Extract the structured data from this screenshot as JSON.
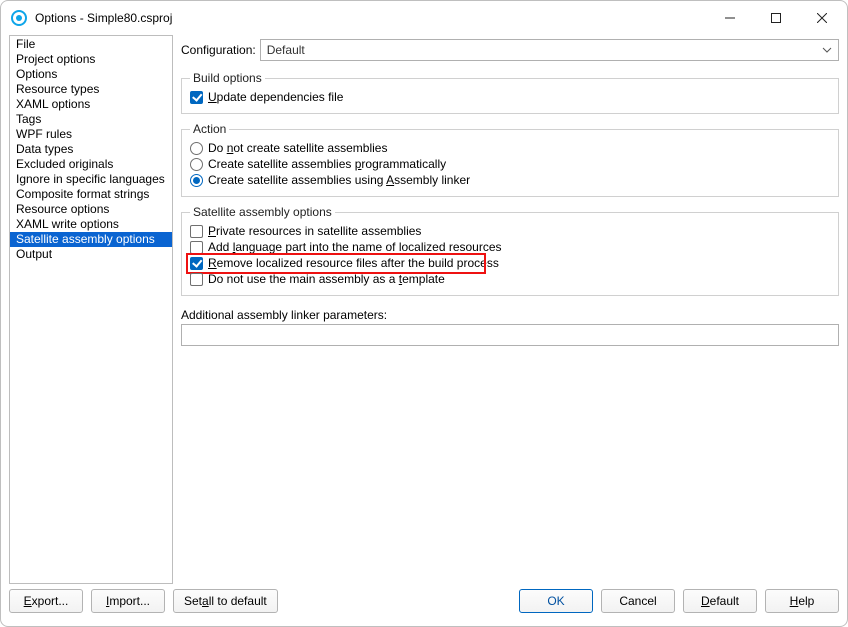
{
  "window": {
    "title": "Options - Simple80.csproj"
  },
  "sidebar": {
    "items": [
      {
        "label": "File"
      },
      {
        "label": "Project options"
      },
      {
        "label": "Options"
      },
      {
        "label": "Resource types"
      },
      {
        "label": "XAML options"
      },
      {
        "label": "Tags"
      },
      {
        "label": "WPF rules"
      },
      {
        "label": "Data types"
      },
      {
        "label": "Excluded originals"
      },
      {
        "label": "Ignore in specific languages"
      },
      {
        "label": "Composite format strings"
      },
      {
        "label": "Resource options"
      },
      {
        "label": "XAML write options"
      },
      {
        "label": "Satellite assembly options",
        "selected": true
      },
      {
        "label": "Output"
      }
    ]
  },
  "config": {
    "label": "Configuration:",
    "value": "Default"
  },
  "build": {
    "legend": "Build options",
    "update_pre": "",
    "update_mne": "U",
    "update_post": "pdate dependencies file",
    "update_checked": true
  },
  "action": {
    "legend": "Action",
    "r1_pre": "Do ",
    "r1_mne": "n",
    "r1_post": "ot create satellite assemblies",
    "r2_pre": "Create satellite assemblies ",
    "r2_mne": "p",
    "r2_post": "rogrammatically",
    "r3_pre": "Create satellite assemblies using ",
    "r3_mne": "A",
    "r3_post": "ssembly linker",
    "selected": 3
  },
  "sat": {
    "legend": "Satellite assembly options",
    "c1_pre": "",
    "c1_mne": "P",
    "c1_post": "rivate resources in satellite assemblies",
    "c2_pre": "Add ",
    "c2_mne": "l",
    "c2_post": "anguage part into the name of localized resources",
    "c3_pre": "",
    "c3_mne": "R",
    "c3_post": "emove localized resource files after the build process",
    "c4_pre": "Do not use the main assembly as a ",
    "c4_mne": "t",
    "c4_post": "emplate",
    "c1_checked": false,
    "c2_checked": false,
    "c3_checked": true,
    "c4_checked": false
  },
  "params": {
    "label": "Additional assembly linker parameters:",
    "value": ""
  },
  "footer": {
    "export_pre": "",
    "export_mne": "E",
    "export_post": "xport...",
    "import_pre": "",
    "import_mne": "I",
    "import_post": "mport...",
    "reset_pre": "Set ",
    "reset_mne": "a",
    "reset_post": "ll to default",
    "ok": "OK",
    "cancel": "Cancel",
    "default_pre": "",
    "default_mne": "D",
    "default_post": "efault",
    "help_pre": "",
    "help_mne": "H",
    "help_post": "elp"
  }
}
